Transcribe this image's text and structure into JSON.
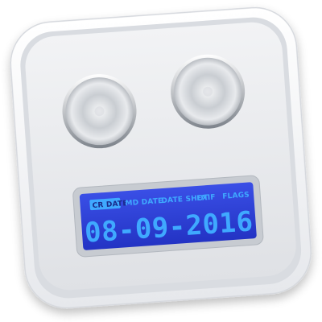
{
  "icon_name": "clock-dials-icon",
  "display": {
    "modes": [
      {
        "label": "CR DATE",
        "selected": true
      },
      {
        "label": "MD DATE",
        "selected": false
      },
      {
        "label": "DATE SHOT",
        "selected": false
      },
      {
        "label": "EXIF",
        "selected": false
      },
      {
        "label": "FLAGS",
        "selected": false
      }
    ],
    "date_text": "08-09-2016"
  },
  "colors": {
    "lcd_background": "#2d3fd6",
    "lcd_text": "#3fa9ff",
    "selected_chip_bg": "#3fa9ff",
    "selected_chip_text": "#1a2a8a"
  }
}
